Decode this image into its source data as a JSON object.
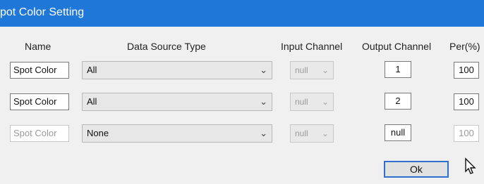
{
  "dialog": {
    "title": "pot Color Setting"
  },
  "headers": {
    "name": "Name",
    "data_source_type": "Data Source Type",
    "input_channel": "Input Channel",
    "output_channel": "Output Channel",
    "per": "Per(%)"
  },
  "rows": [
    {
      "name": "Spot Color",
      "data_source": "All",
      "input_channel": "null",
      "output_channel": "1",
      "per": "100"
    },
    {
      "name": "Spot Color",
      "data_source": "All",
      "input_channel": "null",
      "output_channel": "2",
      "per": "100"
    },
    {
      "name": "Spot Color",
      "data_source": "None",
      "input_channel": "null",
      "output_channel": "null",
      "per": "100"
    }
  ],
  "buttons": {
    "ok": "Ok"
  },
  "icons": {
    "dropdown": "chevron-down-icon",
    "cursor": "mouse-cursor-icon"
  }
}
